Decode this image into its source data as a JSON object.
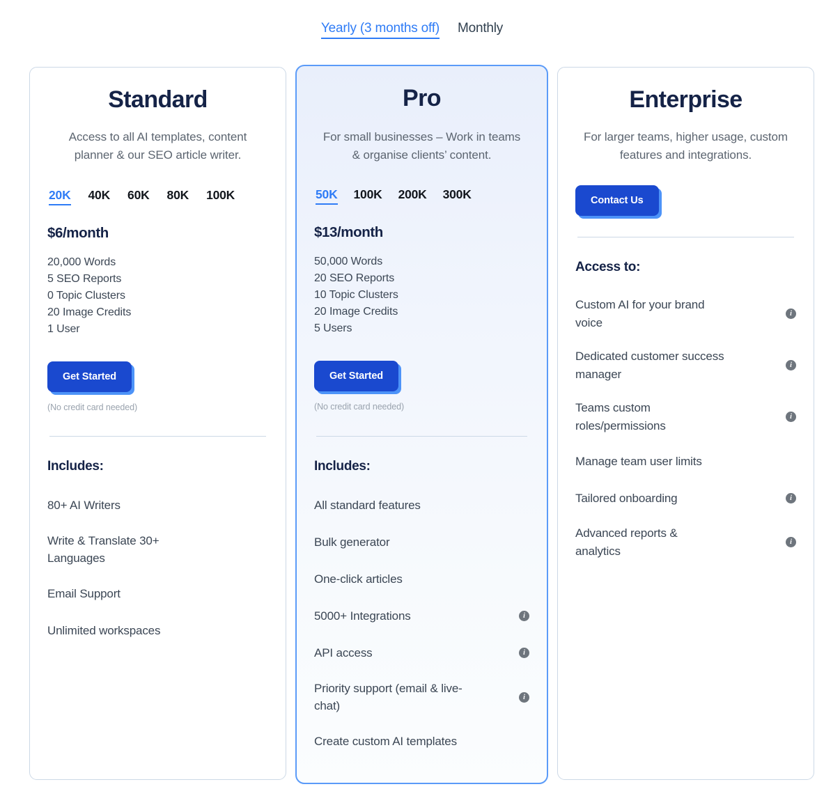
{
  "billing": {
    "options": [
      {
        "label": "Yearly (3 months off)",
        "active": true
      },
      {
        "label": "Monthly",
        "active": false
      }
    ]
  },
  "colors": {
    "accent_blue": "#2f7cf6",
    "button_blue": "#1a49cf",
    "button_shadow_blue": "#4d93f8",
    "featured_border": "#5b9bf8",
    "card_border": "#ccd8e6",
    "title_navy": "#152347",
    "body_gray": "#3b4654",
    "muted_gray": "#9aa3ae",
    "info_icon_gray": "#6e757d"
  },
  "plans": {
    "standard": {
      "title": "Standard",
      "description": "Access to all AI templates, content planner & our SEO article writer.",
      "tiers": [
        "20K",
        "40K",
        "60K",
        "80K",
        "100K"
      ],
      "selected_tier": "20K",
      "price": "$6/month",
      "quotas": [
        "20,000 Words",
        "5 SEO Reports",
        "0 Topic Clusters",
        "20 Image Credits",
        "1 User"
      ],
      "cta_label": "Get Started",
      "cta_note": "(No credit card needed)",
      "features_title": "Includes:",
      "features": [
        {
          "text": "80+ AI Writers",
          "info": false
        },
        {
          "text": "Write & Translate 30+ Languages",
          "info": false
        },
        {
          "text": "Email Support",
          "info": false
        },
        {
          "text": "Unlimited workspaces",
          "info": false
        }
      ]
    },
    "pro": {
      "title": "Pro",
      "description": "For small businesses – Work in teams & organise clients’ content.",
      "tiers": [
        "50K",
        "100K",
        "200K",
        "300K"
      ],
      "selected_tier": "50K",
      "price": "$13/month",
      "quotas": [
        "50,000 Words",
        "20 SEO Reports",
        "10 Topic Clusters",
        "20 Image Credits",
        "5 Users"
      ],
      "cta_label": "Get Started",
      "cta_note": "(No credit card needed)",
      "features_title": "Includes:",
      "features": [
        {
          "text": "All standard features",
          "info": false
        },
        {
          "text": "Bulk generator",
          "info": false
        },
        {
          "text": "One-click articles",
          "info": false
        },
        {
          "text": "5000+ Integrations",
          "info": true
        },
        {
          "text": "API access",
          "info": true
        },
        {
          "text": "Priority support (email & live-chat)",
          "info": true
        },
        {
          "text": "Create custom AI templates",
          "info": false
        }
      ]
    },
    "enterprise": {
      "title": "Enterprise",
      "description": "For larger teams, higher usage, custom features and integrations.",
      "cta_label": "Contact Us",
      "features_title": "Access to:",
      "features": [
        {
          "text": "Custom AI for your brand voice",
          "info": true
        },
        {
          "text": "Dedicated customer success manager",
          "info": true
        },
        {
          "text": "Teams custom roles/permissions",
          "info": true
        },
        {
          "text": "Manage team user limits",
          "info": false
        },
        {
          "text": "Tailored onboarding",
          "info": true
        },
        {
          "text": "Advanced reports & analytics",
          "info": true
        }
      ]
    }
  },
  "icons": {
    "info": "i"
  }
}
